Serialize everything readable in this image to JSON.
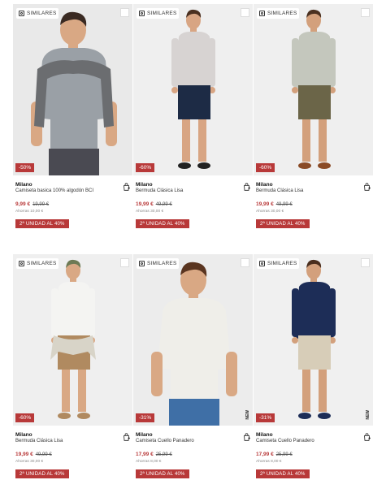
{
  "common": {
    "similar_label": "SIMILARES",
    "brand": "Milano",
    "promo_label": "2ª UNIDAD AL 40%"
  },
  "products": [
    {
      "name": "Camiseta basica 100% algodón BCI",
      "discount": "-50%",
      "price": "9,99 €",
      "old_price": "19,99 €",
      "savings": "Ahorras 10,00 €",
      "colors": {
        "bg": "#e9e9e9",
        "top": "#9aa0a6",
        "bottom": "#4a4a52",
        "skin": "#d9a884",
        "hair": "#3a2a22",
        "shoes": "#3a3a3a",
        "sweater": "#6b6d70"
      }
    },
    {
      "name": "Bermuda Clásica Lisa",
      "discount": "-60%",
      "price": "19,99 €",
      "old_price": "49,99 €",
      "savings": "Ahorras 30,00 €",
      "colors": {
        "bg": "#efefef",
        "top": "#d7d3d2",
        "bottom": "#1d2b45",
        "skin": "#d8a583",
        "hair": "#4a3020",
        "shoes": "#222222"
      }
    },
    {
      "name": "Bermuda Clásica Lisa",
      "discount": "-60%",
      "price": "19,99 €",
      "old_price": "49,99 €",
      "savings": "Ahorras 30,00 €",
      "colors": {
        "bg": "#efefef",
        "top": "#c4c7bd",
        "bottom": "#6b6548",
        "skin": "#d3a07c",
        "hair": "#4a3020",
        "shoes": "#8a4a25"
      }
    },
    {
      "name": "Bermuda Clásica Lisa",
      "discount": "-60%",
      "price": "19,99 €",
      "old_price": "49,99 €",
      "savings": "Ahorras 30,00 €",
      "colors": {
        "bg": "#efefef",
        "top": "#f4f4f2",
        "bottom": "#b08a60",
        "skin": "#d9a884",
        "hair": "#6d7a55",
        "shoes": "#b08a60",
        "sweater": "#d8d4c8"
      }
    },
    {
      "name": "Camiseta Cuello Panadero",
      "discount": "-31%",
      "price": "17,99 €",
      "old_price": "25,99 €",
      "savings": "Ahorras 8,00 €",
      "new_tag": "NEW",
      "colors": {
        "bg": "#ececec",
        "top": "#efeee9",
        "bottom": "#3f6fa6",
        "skin": "#d9a884",
        "hair": "#5a3520",
        "shoes": "#222222"
      }
    },
    {
      "name": "Camiseta Cuello Panadero",
      "discount": "-31%",
      "price": "17,99 €",
      "old_price": "25,99 €",
      "savings": "Ahorras 8,00 €",
      "new_tag": "NEW",
      "colors": {
        "bg": "#f0f0f0",
        "top": "#1d2d57",
        "bottom": "#d7cdb8",
        "skin": "#d3a07c",
        "hair": "#4a2e1e",
        "shoes": "#1d2d57"
      }
    }
  ]
}
